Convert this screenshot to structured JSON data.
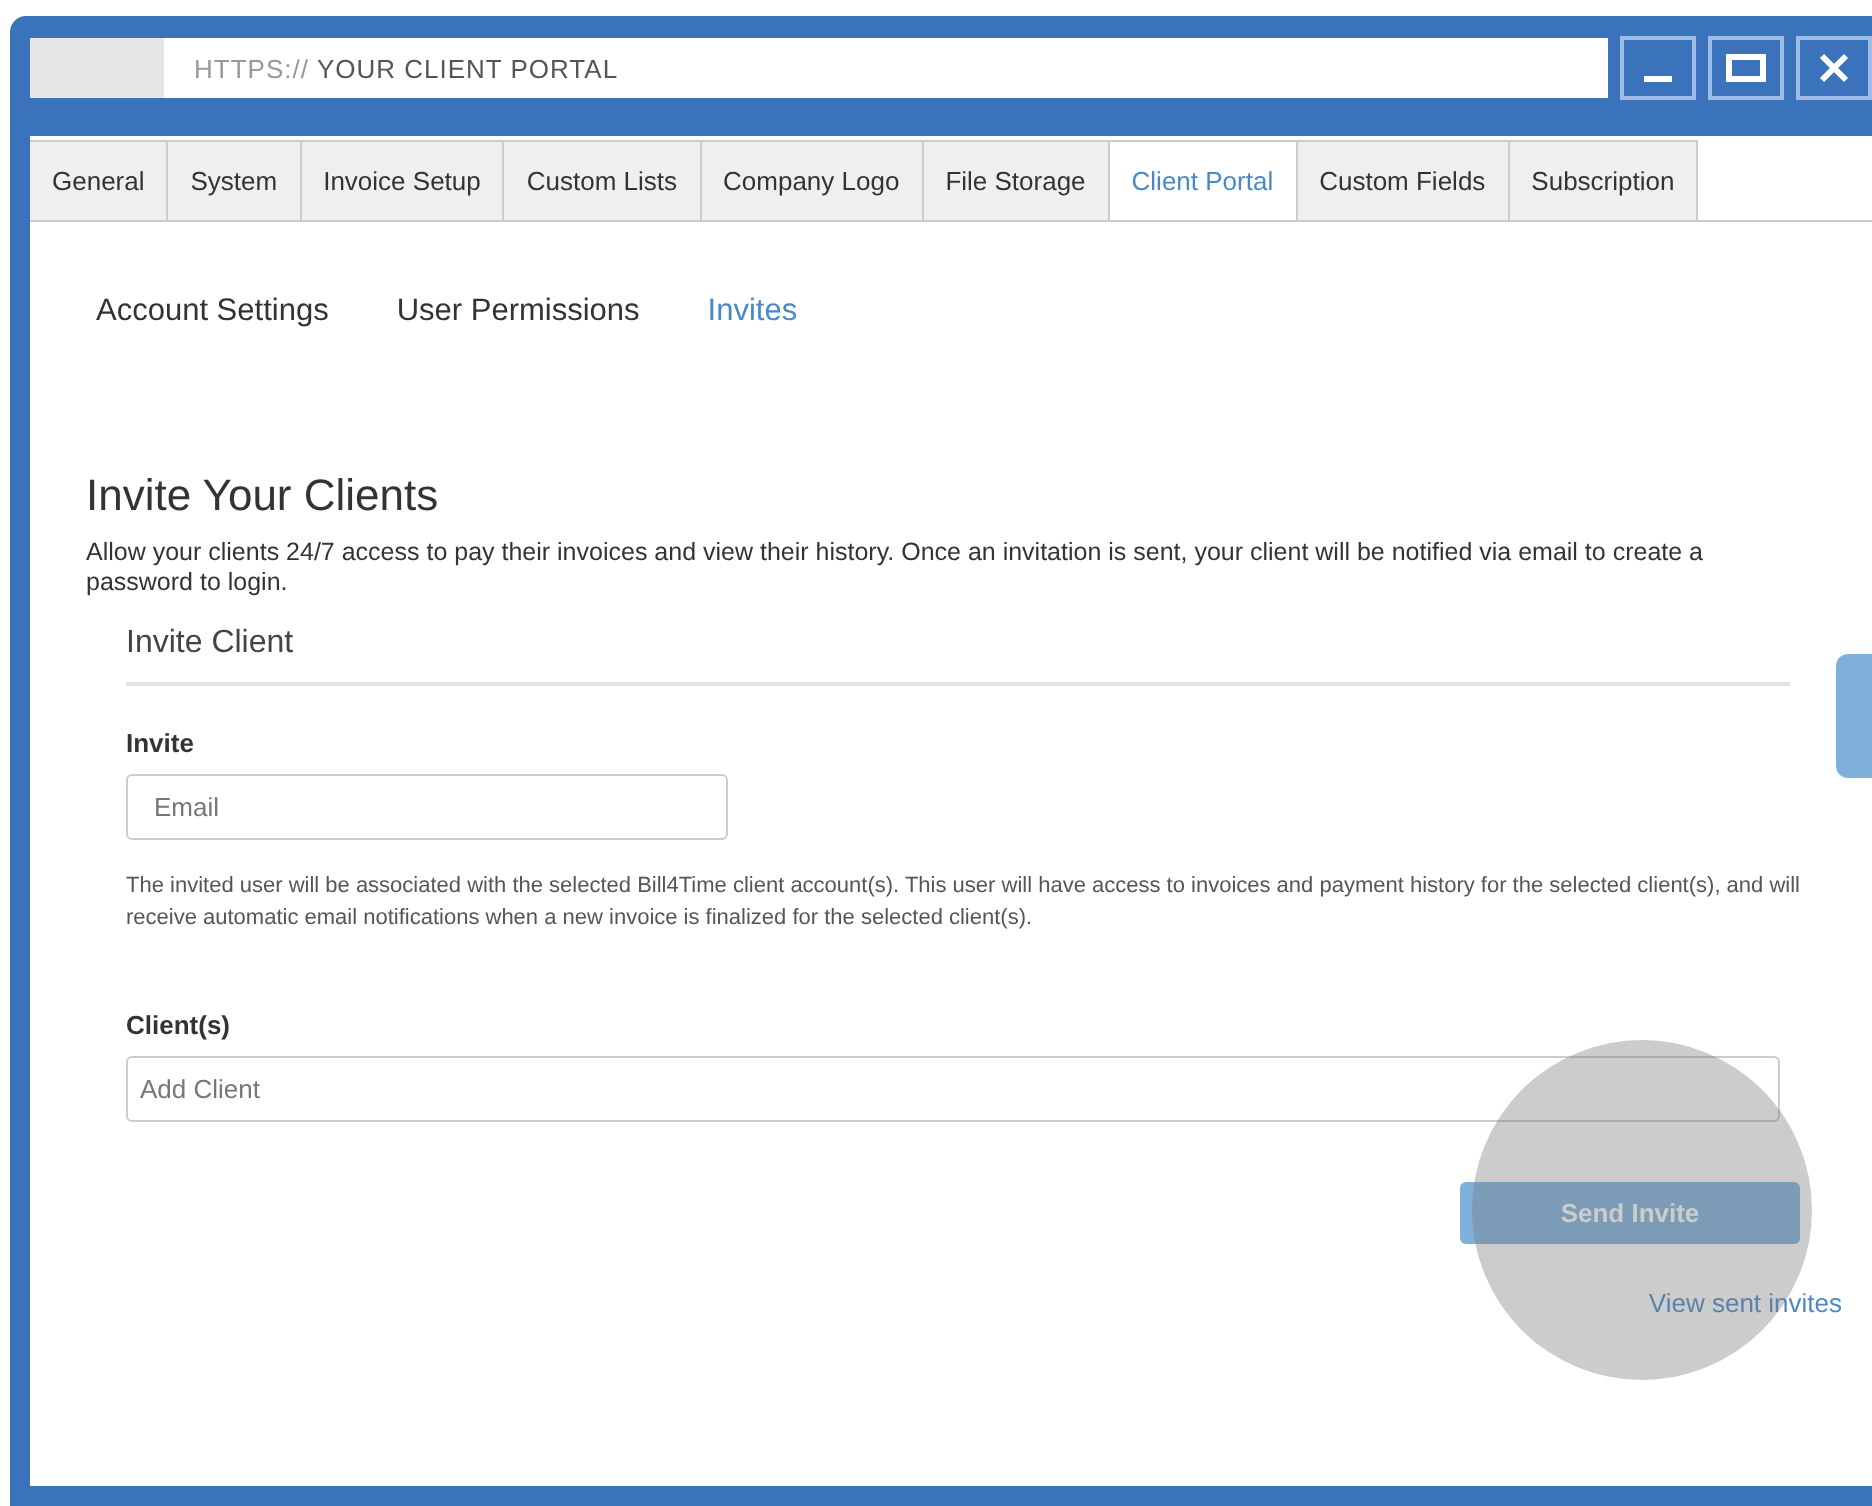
{
  "window": {
    "url": {
      "scheme": "HTTPS://",
      "path": "YOUR CLIENT PORTAL"
    }
  },
  "tabs": [
    {
      "label": "General",
      "selected": false
    },
    {
      "label": "System",
      "selected": false
    },
    {
      "label": "Invoice Setup",
      "selected": false
    },
    {
      "label": "Custom Lists",
      "selected": false
    },
    {
      "label": "Company Logo",
      "selected": false
    },
    {
      "label": "File Storage",
      "selected": false
    },
    {
      "label": "Client Portal",
      "selected": true
    },
    {
      "label": "Custom Fields",
      "selected": false
    },
    {
      "label": "Subscription",
      "selected": false
    }
  ],
  "subtabs": [
    {
      "label": "Account Settings",
      "selected": false
    },
    {
      "label": "User Permissions",
      "selected": false
    },
    {
      "label": "Invites",
      "selected": true
    }
  ],
  "page": {
    "title": "Invite Your Clients",
    "description": "Allow your clients 24/7 access to pay their invoices and view their history. Once an invitation is sent, your client will be notified via email to create a password to login."
  },
  "form": {
    "title": "Invite Client",
    "invite_label": "Invite",
    "email": {
      "placeholder": "Email"
    },
    "help": "The invited user will be associated with the selected Bill4Time client account(s). This user will have access to invoices and payment history for the selected client(s), and will receive automatic email notifications when a new invoice is finalized for the selected client(s).",
    "clients_label": "Client(s)",
    "clients": {
      "placeholder": "Add Client"
    },
    "send_button": "Send Invite",
    "view_link": "View sent invites"
  }
}
